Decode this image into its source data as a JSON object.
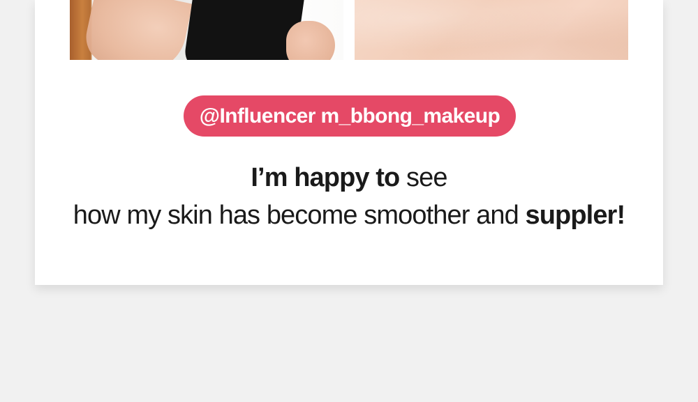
{
  "badge": {
    "label": "@Influencer m_bbong_makeup",
    "color": "#e54966"
  },
  "quote": {
    "line1_bold": "I’m happy to",
    "line1_rest": " see",
    "line2_rest": "how my skin has become smoother and ",
    "line2_bold": "suppler!"
  },
  "photos": [
    {
      "name": "influencer-photo",
      "description": ""
    },
    {
      "name": "skin-closeup-photo",
      "description": ""
    }
  ],
  "colors": {
    "page_background": "#f1f1f1",
    "card_background": "#ffffff",
    "text": "#1a1a1a"
  }
}
